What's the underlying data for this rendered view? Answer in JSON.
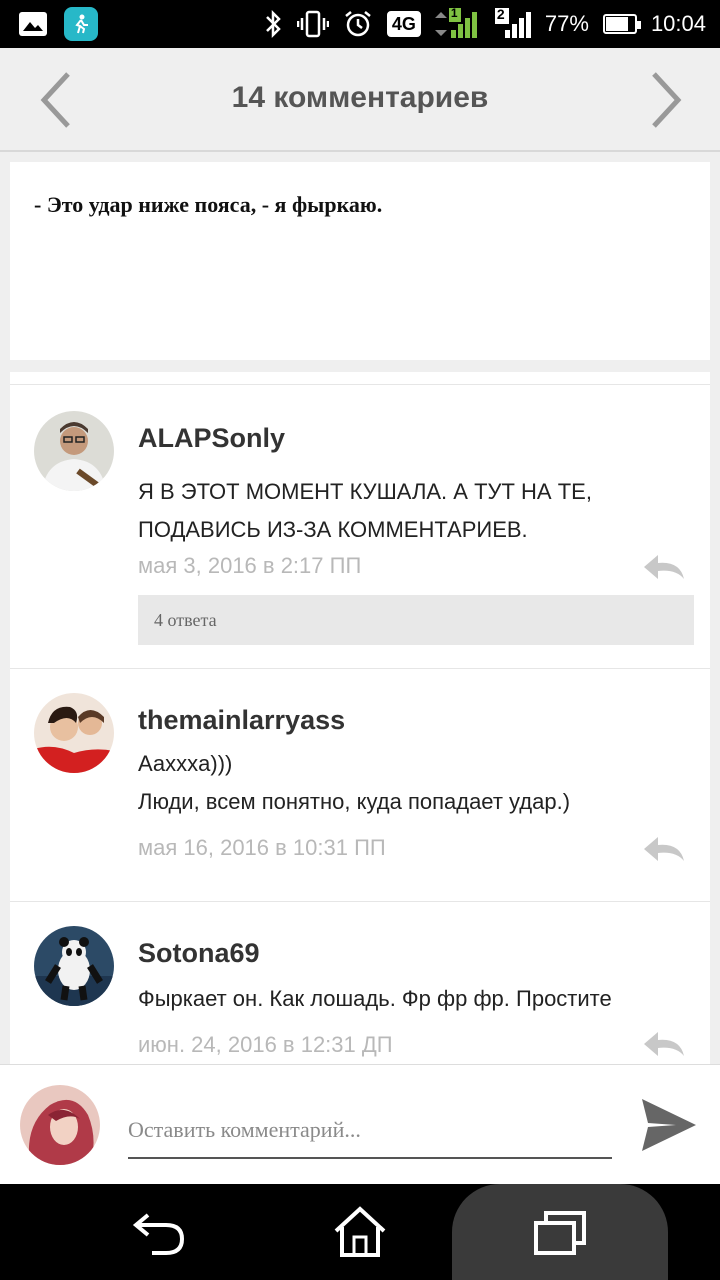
{
  "status_bar": {
    "network": "4G",
    "sim1": "1",
    "sim2": "2",
    "battery": "77%",
    "battery_level": 0.77,
    "time": "10:04",
    "icons": [
      "gallery-icon",
      "fitness-app-icon",
      "bluetooth-icon",
      "vibrate-icon",
      "alarm-icon",
      "signal-icon",
      "battery-icon"
    ]
  },
  "header": {
    "title": "14 комментариев",
    "prev_icon": "chevron-left-icon",
    "next_icon": "chevron-right-icon"
  },
  "excerpt": {
    "text": "- Это удар ниже пояса, - я фыркаю."
  },
  "comments": [
    {
      "author": "ALAPSonly",
      "lines": [
        "Я В ЭТОТ МОМЕНТ КУШАЛА. А ТУТ НА ТЕ,",
        "ПОДАВИСЬ ИЗ-ЗА КОММЕНТАРИЕВ."
      ],
      "date": "мая 3, 2016 в 2:17 ПП",
      "replies_label": "4 ответа"
    },
    {
      "author": "themainlarryass",
      "lines": [
        "Аахххa)))",
        "Люди, всем понятно, куда попадает удар.)"
      ],
      "date": "мая 16, 2016 в 10:31 ПП"
    },
    {
      "author": "Sotona69",
      "lines": [
        "Фыркает он. Как лошадь.  Фр фр фр.  Простите"
      ],
      "date": "июн. 24, 2016 в 12:31 ДП"
    }
  ],
  "composer": {
    "placeholder": "Оставить комментарий...",
    "send_icon": "send-icon"
  },
  "nav_bar": {
    "icons": [
      "back-icon",
      "home-icon",
      "recents-icon"
    ]
  },
  "colors": {
    "header_bg": "#efefef",
    "muted_text": "#b8b8b8",
    "app_icon": "#27b8c8"
  }
}
